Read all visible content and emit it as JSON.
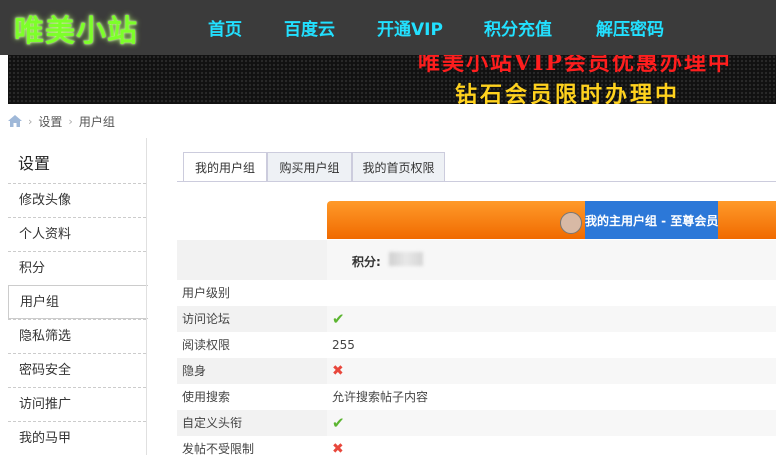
{
  "site": {
    "logo": "唯美小站",
    "nav": [
      "首页",
      "百度云",
      "开通VIP",
      "积分充值",
      "解压密码"
    ]
  },
  "banner": {
    "line1": "唯美小站VIP会员优惠办理中",
    "line2": "钻石会员限时办理中"
  },
  "breadcrumb": [
    "设置",
    "用户组"
  ],
  "sidebar": {
    "title": "设置",
    "items": [
      {
        "label": "修改头像",
        "active": false
      },
      {
        "label": "个人资料",
        "active": false
      },
      {
        "label": "积分",
        "active": false
      },
      {
        "label": "用户组",
        "active": true
      },
      {
        "label": "隐私筛选",
        "active": false
      },
      {
        "label": "密码安全",
        "active": false
      },
      {
        "label": "访问推广",
        "active": false
      },
      {
        "label": "我的马甲",
        "active": false
      }
    ]
  },
  "tabs": [
    {
      "label": "我的用户组",
      "active": true
    },
    {
      "label": "购买用户组",
      "active": false
    },
    {
      "label": "我的首页权限",
      "active": false
    }
  ],
  "group": {
    "main_group_label": "我的主用户组 - 至尊会员",
    "score_label": "积分:"
  },
  "permissions": [
    {
      "name": "用户级别",
      "value": ""
    },
    {
      "name": "访问论坛",
      "value": "✔"
    },
    {
      "name": "阅读权限",
      "value": "255"
    },
    {
      "name": "隐身",
      "value": "✖"
    },
    {
      "name": "使用搜索",
      "value": "允许搜索帖子内容"
    },
    {
      "name": "自定义头衔",
      "value": "✔"
    },
    {
      "name": "发帖不受限制",
      "value": "✖"
    }
  ],
  "colors": {
    "accent_nav": "#22e0ff",
    "logo": "#7dff2a",
    "orange": "#f07a10",
    "blue": "#2c78d8",
    "check": "#5cb531",
    "cross": "#e8473c"
  }
}
